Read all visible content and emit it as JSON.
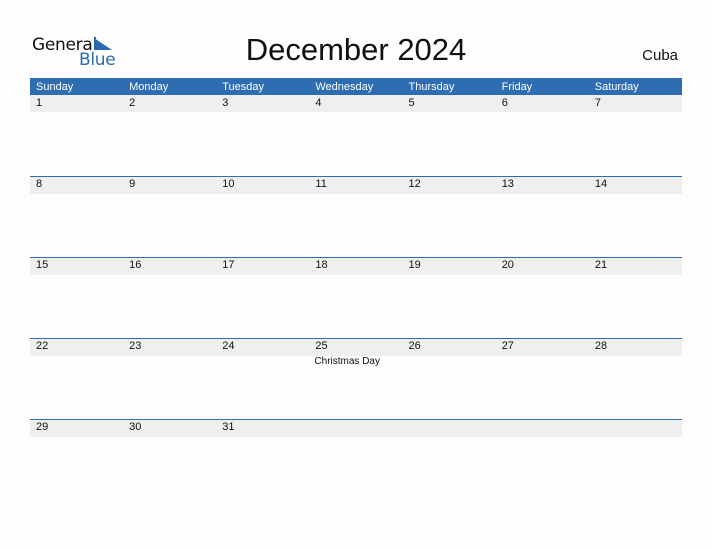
{
  "logo": {
    "word1": "General",
    "word2": "Blue"
  },
  "title": "December 2024",
  "country": "Cuba",
  "colors": {
    "accent": "#2e6db1",
    "strip": "#efefef"
  },
  "weekdays": [
    "Sunday",
    "Monday",
    "Tuesday",
    "Wednesday",
    "Thursday",
    "Friday",
    "Saturday"
  ],
  "weeks": [
    [
      {
        "d": "1"
      },
      {
        "d": "2"
      },
      {
        "d": "3"
      },
      {
        "d": "4"
      },
      {
        "d": "5"
      },
      {
        "d": "6"
      },
      {
        "d": "7"
      }
    ],
    [
      {
        "d": "8"
      },
      {
        "d": "9"
      },
      {
        "d": "10"
      },
      {
        "d": "11"
      },
      {
        "d": "12"
      },
      {
        "d": "13"
      },
      {
        "d": "14"
      }
    ],
    [
      {
        "d": "15"
      },
      {
        "d": "16"
      },
      {
        "d": "17"
      },
      {
        "d": "18"
      },
      {
        "d": "19"
      },
      {
        "d": "20"
      },
      {
        "d": "21"
      }
    ],
    [
      {
        "d": "22"
      },
      {
        "d": "23"
      },
      {
        "d": "24"
      },
      {
        "d": "25",
        "event": "Christmas Day"
      },
      {
        "d": "26"
      },
      {
        "d": "27"
      },
      {
        "d": "28"
      }
    ],
    [
      {
        "d": "29"
      },
      {
        "d": "30"
      },
      {
        "d": "31"
      },
      {
        "d": ""
      },
      {
        "d": ""
      },
      {
        "d": ""
      },
      {
        "d": ""
      }
    ]
  ]
}
